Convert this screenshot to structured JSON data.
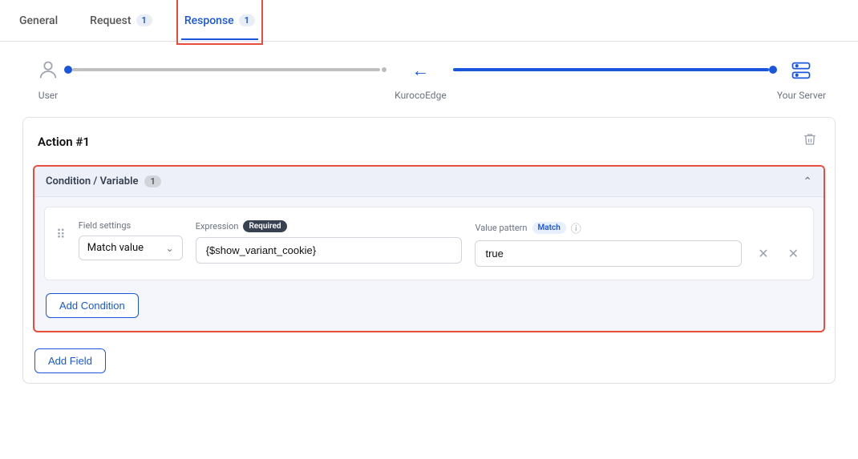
{
  "tabs": [
    {
      "id": "general",
      "label": "General",
      "badge": null,
      "active": false
    },
    {
      "id": "request",
      "label": "Request",
      "badge": "1",
      "active": false
    },
    {
      "id": "response",
      "label": "Response",
      "badge": "1",
      "active": true
    }
  ],
  "flow": {
    "user_label": "User",
    "edge_label": "KurocoEdge",
    "server_label": "Your Server"
  },
  "action": {
    "title": "Action #1",
    "delete_label": "🗑"
  },
  "condition_variable": {
    "title": "Condition / Variable",
    "count": "1",
    "field_settings_label": "Field settings",
    "field_settings_value": "Match value",
    "expression_label": "Expression",
    "required_badge": "Required",
    "expression_value": "{$show_variant_cookie}",
    "expression_placeholder": "",
    "value_pattern_label": "Value pattern",
    "match_badge": "Match",
    "value_pattern_value": "true",
    "add_condition_label": "Add Condition"
  },
  "add_field_label": "Add Field"
}
